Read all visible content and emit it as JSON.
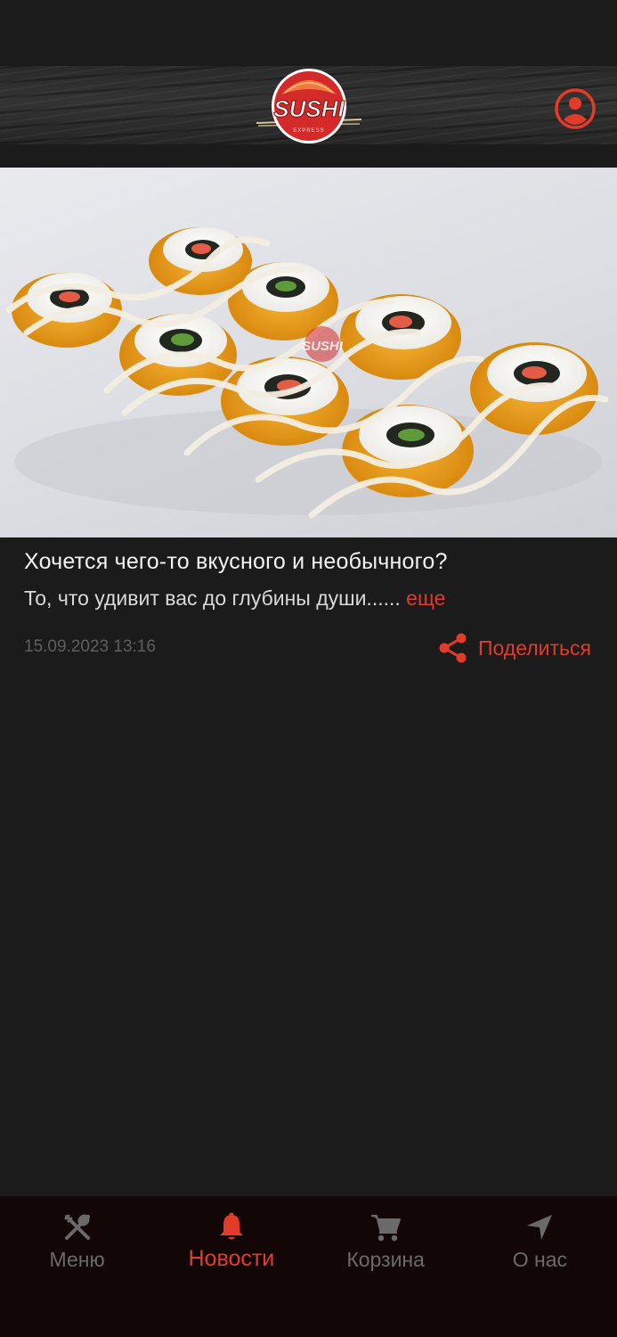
{
  "header": {
    "logo_text": "SUSHI",
    "logo_subtext": "EXPRESS",
    "profile_icon": "user-circle-icon"
  },
  "post": {
    "title": "Хочется чего-то вкусного и необычного?",
    "excerpt": "То, что удивит вас до глубины души......",
    "more_label": "еще",
    "date": "15.09.2023 13:16",
    "share_label": "Поделиться",
    "image_watermark": "SUSHI"
  },
  "nav": {
    "items": [
      {
        "label": "Меню",
        "icon": "fork-knife-icon"
      },
      {
        "label": "Новости",
        "icon": "bell-icon"
      },
      {
        "label": "Корзина",
        "icon": "cart-icon"
      },
      {
        "label": "О нас",
        "icon": "location-arrow-icon"
      }
    ],
    "active_index": 1
  },
  "colors": {
    "accent": "#e23b2a",
    "background": "#1b1b1c",
    "nav_background": "#130606",
    "inactive": "#6a6a6a"
  }
}
